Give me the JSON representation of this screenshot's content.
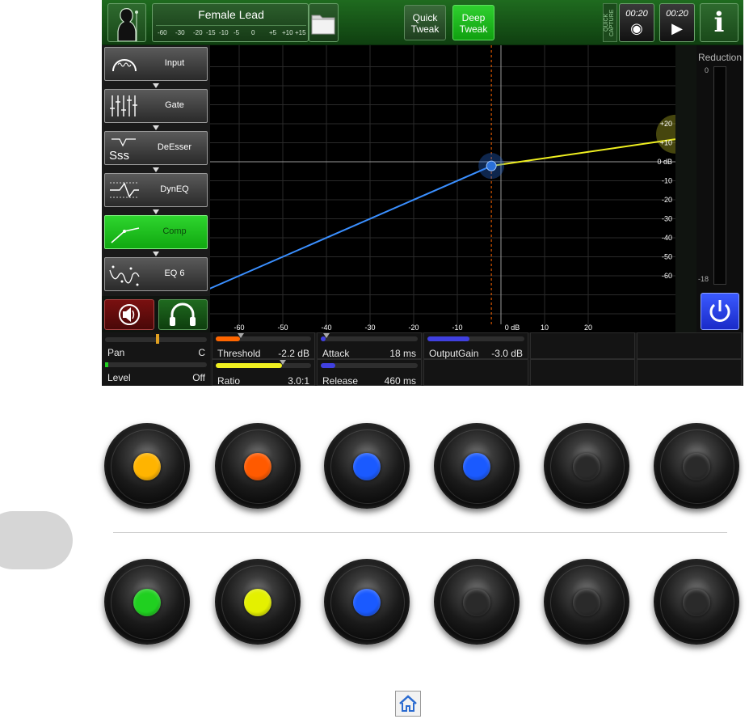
{
  "header": {
    "preset_name": "Female Lead",
    "meter_scale": [
      "-60",
      "-30",
      "-20",
      "-15",
      "-10",
      "-5",
      "0",
      "+5",
      "+10",
      "+15"
    ],
    "quick_tweak_label": "Quick Tweak",
    "deep_tweak_label": "Deep Tweak",
    "quick_capture_label": "QUICK CAPTURE",
    "capture_timer": "00:20",
    "play_timer": "00:20",
    "info_label": "i"
  },
  "modules": [
    {
      "label": "Input",
      "icon": "input-gauge-icon",
      "active": false
    },
    {
      "label": "Gate",
      "icon": "gate-faders-icon",
      "active": false
    },
    {
      "label": "DeEsser",
      "icon": "deesser-sss-icon",
      "active": false
    },
    {
      "label": "DynEQ",
      "icon": "dynamic-eq-icon",
      "active": false
    },
    {
      "label": "Comp",
      "icon": "compressor-curve-icon",
      "active": true
    },
    {
      "label": "EQ 6",
      "icon": "eq-curve-icon",
      "active": false
    }
  ],
  "deesser_glyph": "Sss",
  "graph": {
    "x_ticks": [
      "-60",
      "-50",
      "-40",
      "-30",
      "-20",
      "-10",
      "0 dB",
      "10",
      "20"
    ],
    "y_ticks": [
      "+20",
      "+10",
      "0 dB",
      "-10",
      "-20",
      "-30",
      "-40",
      "-50",
      "-60"
    ],
    "threshold_db": -2.2,
    "ratio": 3.0
  },
  "reduction": {
    "title": "Reduction",
    "top_label": "0",
    "bottom_label": "-18"
  },
  "pan_level": {
    "pan_label": "Pan",
    "pan_value": "C",
    "level_label": "Level",
    "level_value": "Off"
  },
  "params": {
    "threshold_label": "Threshold",
    "threshold_value": "-2.2 dB",
    "ratio_label": "Ratio",
    "ratio_value": "3.0:1",
    "attack_label": "Attack",
    "attack_value": "18 ms",
    "release_label": "Release",
    "release_value": "460 ms",
    "output_gain_label": "OutputGain",
    "output_gain_value": "-3.0 dB"
  },
  "colors": {
    "accent_green": "#22cc22",
    "curve_blue": "#3a8fff",
    "curve_yellow": "#f0f020",
    "threshold_orange": "#ff6600"
  },
  "knobs_top": [
    {
      "color": "#ffb400"
    },
    {
      "color": "#ff5a00"
    },
    {
      "color": "#1a5aff"
    },
    {
      "color": "#1a5aff"
    },
    {
      "color": "#2a2a2a"
    },
    {
      "color": "#2a2a2a"
    }
  ],
  "knobs_bottom": [
    {
      "color": "#20d020"
    },
    {
      "color": "#e4f000"
    },
    {
      "color": "#1a5aff"
    },
    {
      "color": "#2a2a2a"
    },
    {
      "color": "#2a2a2a"
    },
    {
      "color": "#2a2a2a"
    }
  ]
}
